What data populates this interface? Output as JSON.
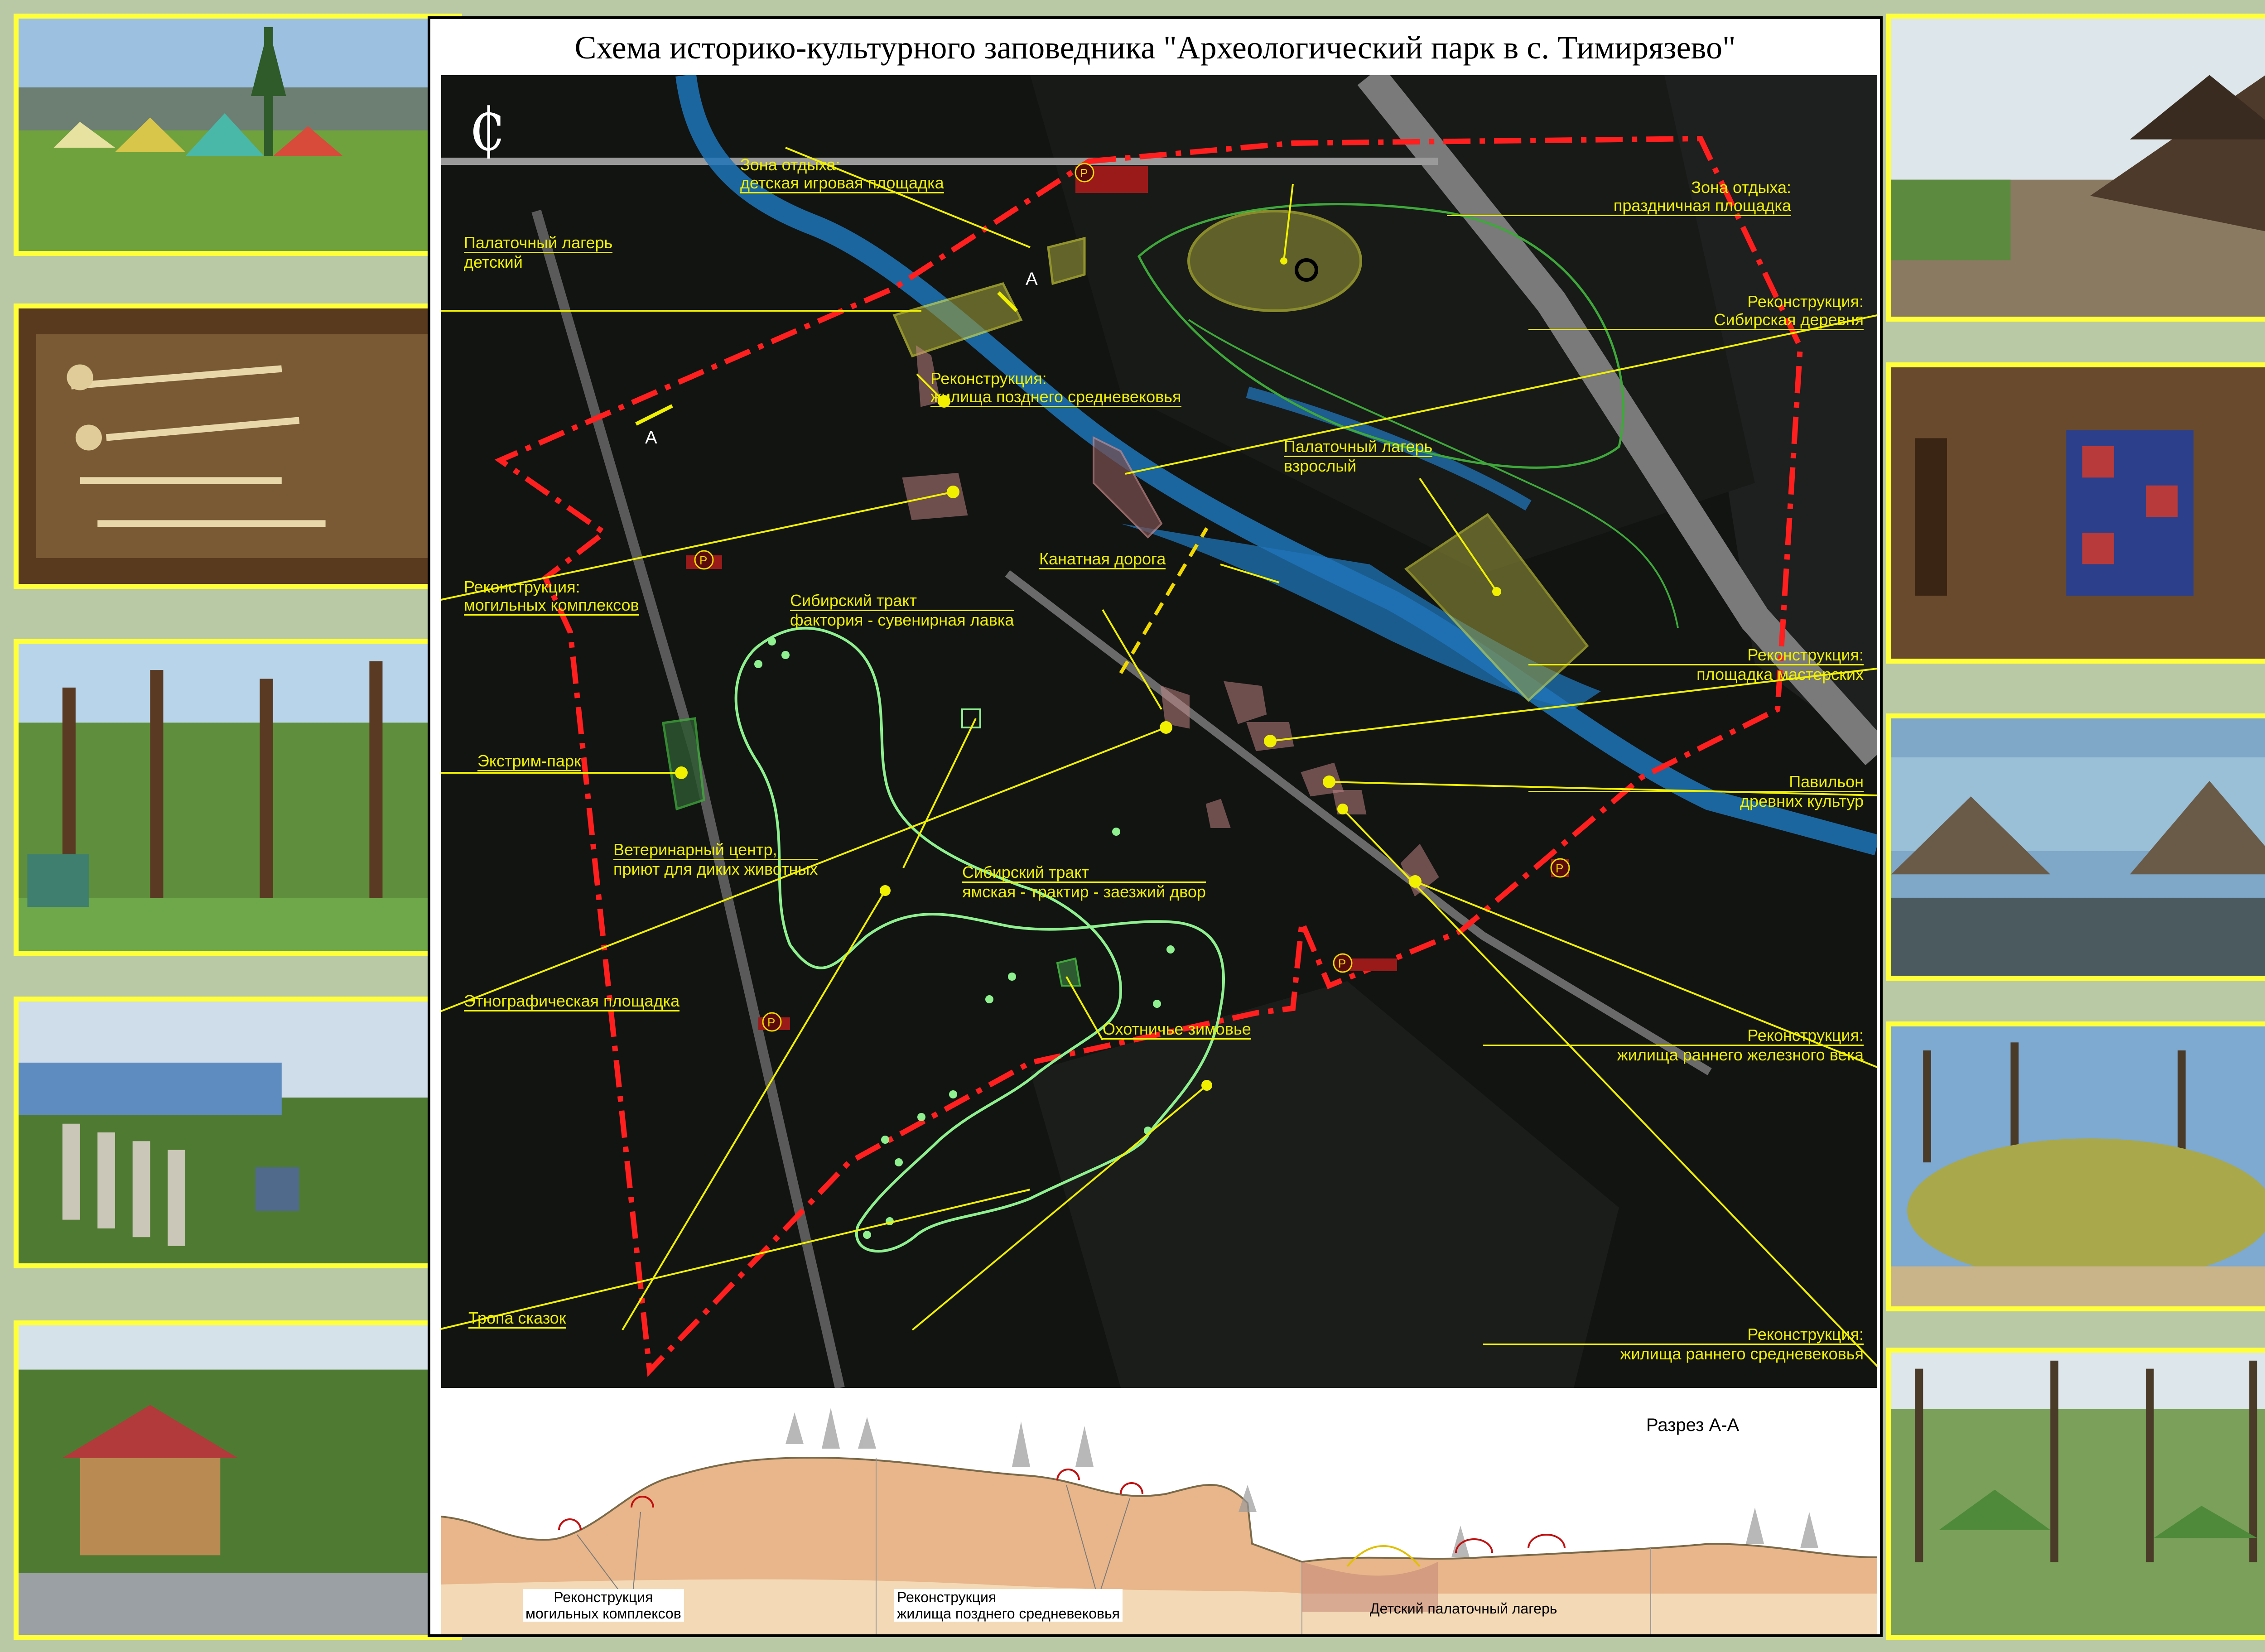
{
  "title": "Схема историко-культурного заповедника \"Археологический парк в с. Тимирязево\"",
  "colors": {
    "background": "#b9c9a6",
    "photo_frame": "#ffff3a",
    "label_text": "#f0f000",
    "boundary": "#ff1f1f",
    "trail": "#8ef08e",
    "river": "#1f74b8",
    "zone_fill": "#b9a93a",
    "reconstruction_fill": "#c98a8a"
  },
  "map": {
    "north_symbol": "₵",
    "parking_symbol": "P",
    "section_mark": "A",
    "labels": {
      "rest_playground": [
        "Зона отдыха:",
        "детская игровая площадка"
      ],
      "rest_festive": [
        "Зона отдыха:",
        "праздничная площадка"
      ],
      "tent_camp_children": [
        "Палаточный лагерь",
        "детский"
      ],
      "recon_siberian_village": [
        "Реконструкция:",
        "Сибирская деревня"
      ],
      "recon_late_medieval": [
        "Реконструкция:",
        "жилища позднего средневековья"
      ],
      "tent_camp_adult": [
        "Палаточный лагерь",
        "взрослый"
      ],
      "cable_road": "Канатная дорога",
      "recon_burial": [
        "Реконструкция:",
        "могильных комплексов"
      ],
      "siberian_trakt_factory": [
        "Сибирский тракт",
        "фактория - сувенирная лавка"
      ],
      "recon_workshops": [
        "Реконструкция:",
        "площадка мастерских"
      ],
      "extreme_park": "Экстрим-парк",
      "pavilion": [
        "Павильон",
        "древних культур"
      ],
      "vet_center": [
        "Ветеринарный центр,",
        "приют для диких животных"
      ],
      "siberian_trakt_yam": [
        "Сибирский тракт",
        "ямская - трактир - заезжий двор"
      ],
      "ethno_site": "Этнографическая площадка",
      "hunting_lodge": "Охотничье зимовье",
      "recon_early_iron": [
        "Реконструкция:",
        "жилища раннего железного века"
      ],
      "fairy_trail": "Тропа сказок",
      "recon_early_medieval": [
        "Реконструкция:",
        "жилища раннего средневековья"
      ]
    }
  },
  "section": {
    "title": "Разрез А-А",
    "labels": {
      "burial": [
        "Реконструкция",
        "могильных комплексов"
      ],
      "late_medieval": [
        "Реконструкция",
        "жилища позднего средневековья"
      ],
      "children_camp": "Детский палаточный лагерь"
    }
  },
  "photos": [
    {
      "name": "tent-camp-photo"
    },
    {
      "name": "burial-photo"
    },
    {
      "name": "rope-park-photo"
    },
    {
      "name": "ethno-site-photo"
    },
    {
      "name": "fairy-trail-photo"
    },
    {
      "name": "siberian-village-photo"
    },
    {
      "name": "interior-photo"
    },
    {
      "name": "pavilion-photo"
    },
    {
      "name": "iron-age-dwelling-photo"
    },
    {
      "name": "early-medieval-dwelling-photo"
    }
  ]
}
